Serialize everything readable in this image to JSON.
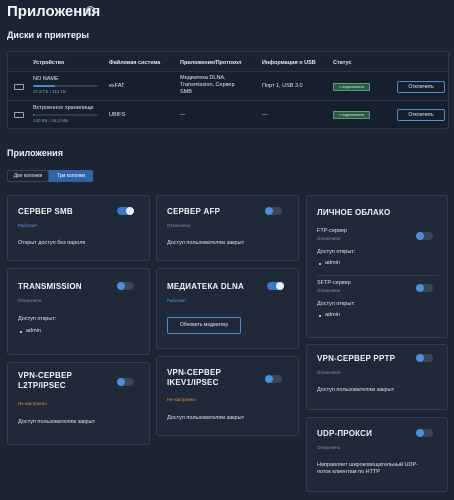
{
  "page": {
    "title": "Приложения",
    "help_icon": "?"
  },
  "disks": {
    "heading": "Диски и принтеры",
    "columns": [
      "Устройство",
      "Файловая система",
      "Приложение/Протокол",
      "Информация о USB",
      "Статус"
    ],
    "rows": [
      {
        "name": "NO NAME",
        "usage": "37,8 ГБ / 112 ГБ",
        "fill": 0.34,
        "fs": "exFAT",
        "apps": [
          "Медиатека DLNA,",
          "Transmission, Сервер",
          "SMB"
        ],
        "usb": "Порт 1, USB 3.0",
        "status": "• подключено",
        "action": "Отключить"
      },
      {
        "name": "Встроенное хранилище",
        "usage": "140 КБ / 16,3 МБ",
        "fill": 0.01,
        "fs": "UBIFS",
        "apps": [
          "—"
        ],
        "usb": "—",
        "status": "• подключено",
        "action": "Отключить"
      }
    ]
  },
  "apps": {
    "heading": "Приложения",
    "view_options": [
      "Две колонки",
      "Три колонки"
    ],
    "selected_view": "Три колонки",
    "cards": {
      "smb": {
        "title": "СЕРВЕР SMB",
        "state": "Работает",
        "on": true,
        "desc": "Открыт доступ без пароля"
      },
      "afp": {
        "title": "СЕРВЕР AFP",
        "state": "Отключено",
        "on": false,
        "desc": "Доступ пользователям закрыт"
      },
      "cloud": {
        "title": "ЛИЧНОЕ ОБЛАКО",
        "ftp": {
          "title": "FTP-сервер",
          "state": "Отключено",
          "on": false,
          "access_label": "Доступ открыт:",
          "user": "admin"
        },
        "sftp": {
          "title": "SFTP-сервер",
          "state": "Отключено",
          "on": false,
          "access_label": "Доступ открыт:",
          "user": "admin"
        }
      },
      "transmission": {
        "title": "TRANSMISSION",
        "state": "Отключено",
        "on": false,
        "access_label": "Доступ открыт:",
        "user": "admin"
      },
      "dlna": {
        "title": "МЕДИАТЕКА DLNA",
        "state": "Работает",
        "on": true,
        "button": "Обновить медиатеку"
      },
      "l2tp": {
        "title_line1": "VPN-СЕРВЕР",
        "title_line2": "L2TP/IPSEC",
        "state": "Не настроено",
        "on": false,
        "desc": "Доступ пользователям закрыт"
      },
      "ikev": {
        "title_line1": "VPN-СЕРВЕР",
        "title_line2": "IKEV1/IPSEC",
        "state": "Не настроено",
        "on": false,
        "desc": "Доступ пользователям закрыт"
      },
      "pptp": {
        "title": "VPN-СЕРВЕР PPTP",
        "state": "Отключено",
        "on": false,
        "desc": "Доступ пользователям закрыт"
      },
      "udp": {
        "title": "UDP-ПРОКСИ",
        "state": "Отключено",
        "on": false,
        "desc_line1": "Направляет широковещательный UDP-",
        "desc_line2": "поток клиентам по HTTP"
      }
    }
  },
  "colors": {
    "accent": "#3a79c9",
    "working": "#5d9be2",
    "not_configured": "#e59a3b",
    "connected": "#2d5a44"
  }
}
